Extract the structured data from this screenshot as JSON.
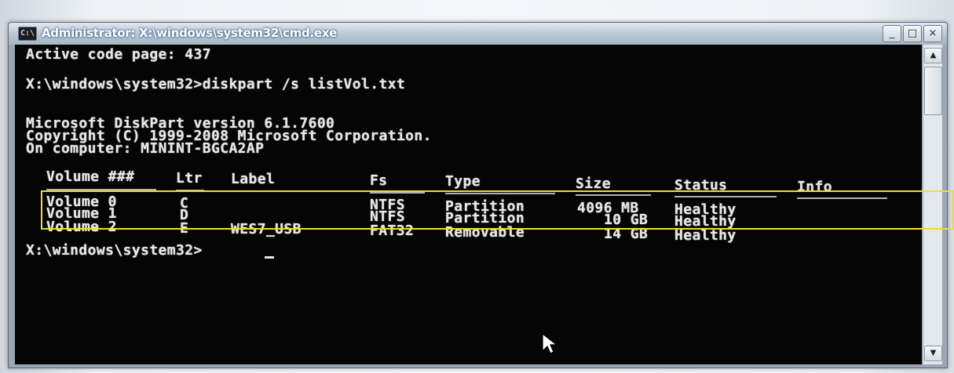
{
  "window": {
    "title": "Administrator: X:\\windows\\system32\\cmd.exe",
    "icon": "cmd-icon",
    "buttons": {
      "minimize": "_",
      "maximize": "□",
      "close": "×"
    }
  },
  "console": {
    "lines": [
      "Active code page: 437",
      "X:\\windows\\system32>diskpart /s listVol.txt",
      "Microsoft DiskPart version 6.1.7600",
      "Copyright (C) 1999-2008 Microsoft Corporation.",
      "On computer: MININT-BGCA2AP"
    ],
    "table": {
      "headers": [
        "Volume ###",
        "Ltr",
        "Label",
        "Fs",
        "Type",
        "Size",
        "Status",
        "Info"
      ],
      "rows": [
        [
          "Volume 0",
          "C",
          "",
          "NTFS",
          "Partition",
          "4096 MB",
          "Healthy",
          ""
        ],
        [
          "Volume 1",
          "D",
          "",
          "NTFS",
          "Partition",
          "10 GB",
          "Healthy",
          ""
        ],
        [
          "Volume 2",
          "E",
          "WES7_USB",
          "FAT32",
          "Removable",
          "14 GB",
          "Healthy",
          ""
        ]
      ]
    },
    "prompt": "X:\\windows\\system32>"
  },
  "colors": {
    "console_bg": "#050505",
    "console_text": "#e6e6e6",
    "highlight": "#e8dd3a"
  }
}
